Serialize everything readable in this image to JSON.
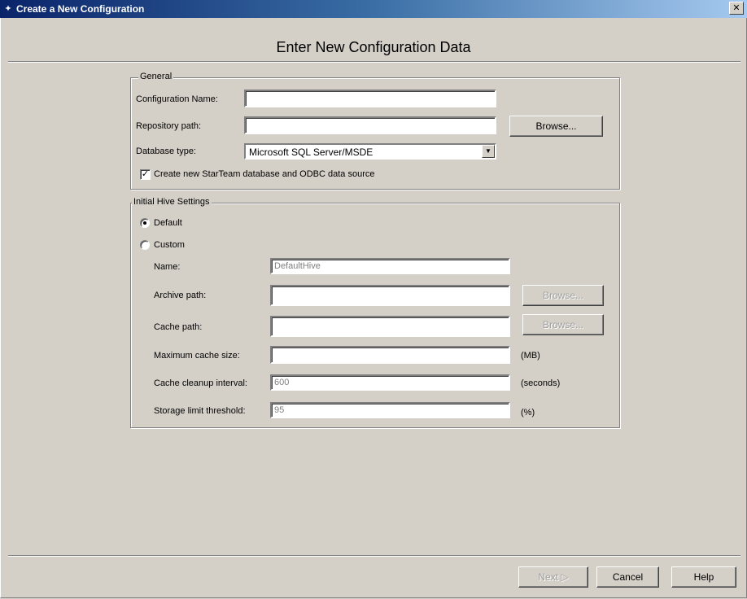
{
  "window": {
    "title": "Create a New Configuration",
    "close_glyph": "✕"
  },
  "heading": "Enter New Configuration Data",
  "general": {
    "legend": "General",
    "config_name_label": "Configuration Name:",
    "config_name_value": "",
    "repo_path_label": "Repository path:",
    "repo_path_value": "",
    "browse_label": "Browse...",
    "db_type_label": "Database type:",
    "db_type_value": "Microsoft SQL Server/MSDE",
    "create_db_checked": true,
    "create_db_label": "Create new StarTeam database and ODBC data source"
  },
  "hive": {
    "legend": "Initial Hive Settings",
    "default_label": "Default",
    "custom_label": "Custom",
    "selected": "Default",
    "name_label": "Name:",
    "name_value": "DefaultHive",
    "archive_label": "Archive path:",
    "archive_value": "",
    "archive_browse": "Browse...",
    "cache_label": "Cache path:",
    "cache_value": "",
    "cache_browse": "Browse...",
    "max_cache_label": "Maximum cache size:",
    "max_cache_value": "",
    "max_cache_unit": "(MB)",
    "cleanup_label": "Cache cleanup interval:",
    "cleanup_value": "600",
    "cleanup_unit": "(seconds)",
    "storage_label": "Storage limit threshold:",
    "storage_value": "95",
    "storage_unit": "(%)"
  },
  "footer": {
    "next_label": "Next ▷",
    "cancel_label": "Cancel",
    "help_label": "Help"
  }
}
